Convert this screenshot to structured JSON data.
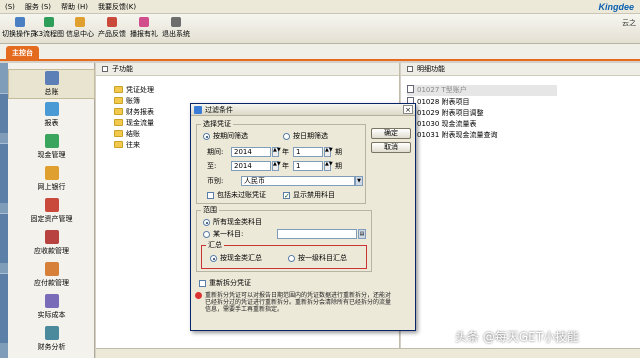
{
  "menubar": {
    "items": [
      "(S)",
      "服务 (S)",
      "帮助 (H)",
      "我要反馈(K)"
    ],
    "brand": "Kingdee"
  },
  "toolbar": {
    "items": [
      "切换操作员",
      "K3流程图",
      "信息中心",
      "产品反馈",
      "播报有礼",
      "退出系统"
    ],
    "right_text": "云之"
  },
  "tab": {
    "main": "主控台"
  },
  "sidebar": {
    "items": [
      "总账",
      "报表",
      "现金管理",
      "网上银行",
      "固定资产管理",
      "应收款管理",
      "应付款管理",
      "实际成本",
      "财务分析"
    ]
  },
  "left_panel": {
    "header": "子功能",
    "tree": [
      "凭证处理",
      "账簿",
      "财务报表",
      "现金流量",
      "结账",
      "往来"
    ]
  },
  "right_panel": {
    "header": "明细功能",
    "items": [
      "01027  T型账户",
      "01028  附表项目",
      "01029  附表项目调整",
      "01030  现金流量表",
      "01031  附表现金流量查询"
    ]
  },
  "dialog": {
    "title": "过滤条件",
    "close": "×",
    "select_voucher": "选择凭证",
    "by_period": "按期间筛选",
    "by_date": "按日期筛选",
    "period_label": "期间:",
    "to_label": "至:",
    "from_year": "2014",
    "from_period": "1",
    "to_year": "2014",
    "to_period": "1",
    "year_unit": "年",
    "period_unit": "期",
    "currency_label": "币别:",
    "currency_value": "人民币",
    "include_unposted": "包括未过账凭证",
    "show_disabled": "显示禁用科目",
    "ok_button": "确定",
    "cancel_button": "取消",
    "range_group": "范围",
    "all_cash_accounts": "所有现金类科目",
    "one_account": "某一科目:",
    "summary_group": "汇总",
    "by_cash_account": "按现金类汇总",
    "by_level1": "按一级科目汇总",
    "reset_split": "重新拆分凭证",
    "note": "重新拆分凭证可以对报告日期范围内的凭证数据进行重新拆分，还能对已经拆分过的凭证进行重新拆分。重新拆分会清除所有已经拆分的流量信息，需要手工再重新指定。"
  },
  "watermark": "头条 @每天GET小技能"
}
